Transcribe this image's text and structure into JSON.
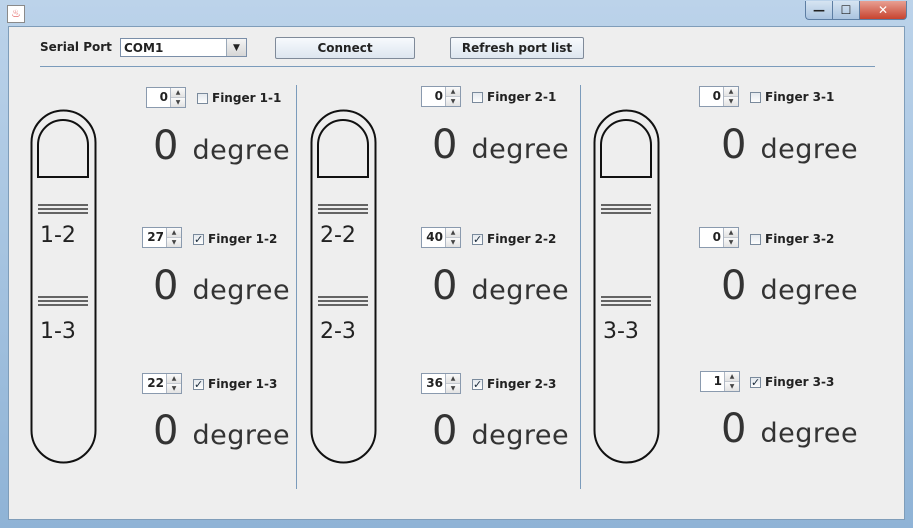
{
  "window": {
    "app_icon": "java-icon",
    "min": "—",
    "max": "☐",
    "close": "✕"
  },
  "toolbar": {
    "serial_port_label": "Serial Port",
    "port_value": "COM1",
    "connect_label": "Connect",
    "refresh_label": "Refresh port list"
  },
  "fingers": {
    "f1": {
      "seg1": "1-2",
      "seg2": "1-3"
    },
    "f2": {
      "seg1": "2-2",
      "seg2": "2-3"
    },
    "f3": {
      "seg1": "3-3"
    }
  },
  "joints": {
    "j11": {
      "value": "0",
      "checked": false,
      "label": "Finger 1-1",
      "degree": "0",
      "unit": "degree"
    },
    "j12": {
      "value": "27",
      "checked": true,
      "label": "Finger 1-2",
      "degree": "0",
      "unit": "degree"
    },
    "j13": {
      "value": "22",
      "checked": true,
      "label": "Finger 1-3",
      "degree": "0",
      "unit": "degree"
    },
    "j21": {
      "value": "0",
      "checked": false,
      "label": "Finger 2-1",
      "degree": "0",
      "unit": "degree"
    },
    "j22": {
      "value": "40",
      "checked": true,
      "label": "Finger 2-2",
      "degree": "0",
      "unit": "degree"
    },
    "j23": {
      "value": "36",
      "checked": true,
      "label": "Finger 2-3",
      "degree": "0",
      "unit": "degree"
    },
    "j31": {
      "value": "0",
      "checked": false,
      "label": "Finger 3-1",
      "degree": "0",
      "unit": "degree"
    },
    "j32": {
      "value": "0",
      "checked": false,
      "label": "Finger 3-2",
      "degree": "0",
      "unit": "degree"
    },
    "j33": {
      "value": "1",
      "checked": true,
      "label": "Finger 3-3",
      "degree": "0",
      "unit": "degree"
    }
  }
}
